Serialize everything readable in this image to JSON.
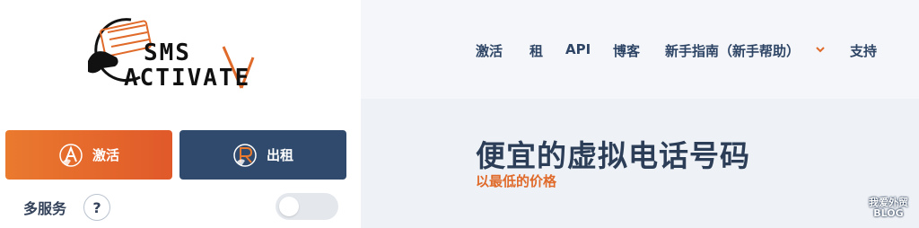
{
  "logo": {
    "line1": "SMS",
    "line2": "ACTIVATE",
    "brand_color": "#ea7a2e"
  },
  "actions": {
    "activate_label": "激活",
    "rent_label": "出租",
    "activate_icon": "activate-a-icon",
    "rent_icon": "rent-r-icon"
  },
  "multi_service": {
    "label": "多服务",
    "help_symbol": "?",
    "toggle_on": false
  },
  "nav": {
    "activate": "激活",
    "rent": "租",
    "api": "API",
    "blog": "博客",
    "guide": "新手指南（新手帮助）",
    "support": "支持"
  },
  "hero": {
    "title": "便宜的虚拟电话号码",
    "subtitle": "以最低的价格"
  },
  "watermark": {
    "line1": "我爱外贸",
    "line2": "BLOG"
  },
  "colors": {
    "accent_orange": "#e0592a",
    "navy": "#2f4a6c",
    "text_dark": "#2c3e57"
  }
}
